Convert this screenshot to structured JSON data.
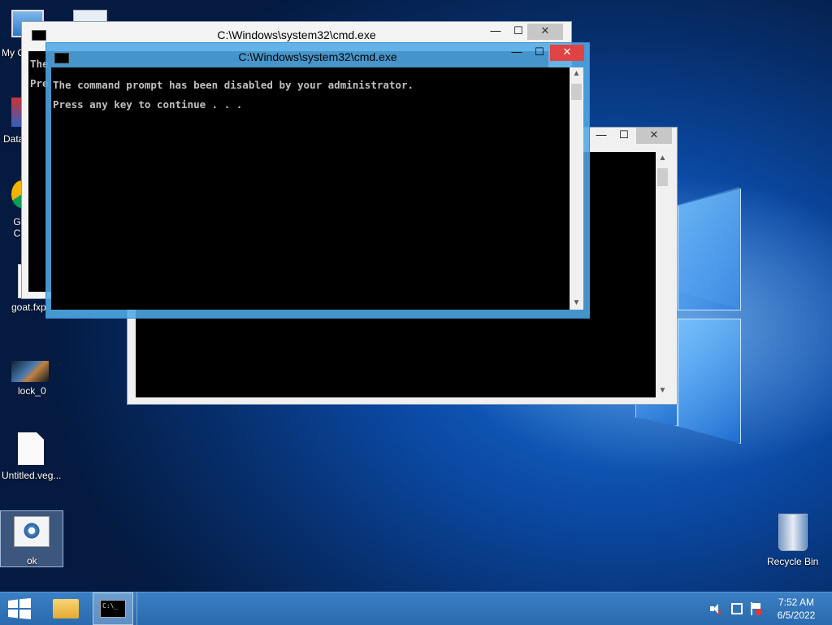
{
  "desktop_icons": [
    {
      "label": "My C"
    },
    {
      "label": "Data"
    },
    {
      "label": "G C"
    },
    {
      "label": "goat.fxp"
    },
    {
      "label": "lock_0"
    },
    {
      "label": "Untitled.veg..."
    },
    {
      "label": "ok"
    },
    {
      "label": "Recycle Bin"
    }
  ],
  "windows": {
    "back": {
      "title": "C:\\Windows\\system32\\cmd.exe",
      "lines": [
        "The",
        "Pre"
      ]
    },
    "front": {
      "title": "C:\\Windows\\system32\\cmd.exe",
      "lines": [
        "The command prompt has been disabled by your administrator.",
        "Press any key to continue . . ."
      ]
    }
  },
  "window_controls": {
    "minimize": "—",
    "maximize": "☐",
    "close": "✕"
  },
  "scroll_arrows": {
    "up": "▲",
    "down": "▼"
  },
  "taskbar": {
    "start_icon": "windows-logo-icon",
    "pinned": [
      "file-explorer-icon",
      "cmd-icon"
    ],
    "cmd_label": "C:\\_"
  },
  "tray": {
    "time": "7:52 AM",
    "date": "6/5/2022"
  },
  "colors": {
    "accent": "#4aa3df",
    "close": "#e04343",
    "console_bg": "#000000",
    "console_fg": "#c0c0c0"
  }
}
